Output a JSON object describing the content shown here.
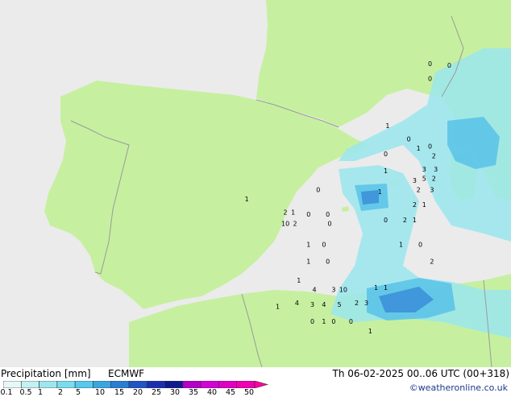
{
  "header": {
    "title": "Precipitation [mm]",
    "model": "ECMWF",
    "datetime": "Th 06-02-2025 00..06 UTC (00+318)",
    "credit": "©weatheronline.co.uk"
  },
  "legend": {
    "levels": [
      "0.1",
      "0.5",
      "1",
      "2",
      "5",
      "10",
      "15",
      "20",
      "25",
      "30",
      "35",
      "40",
      "45",
      "50"
    ],
    "colors": [
      "#e6f7f7",
      "#c3f0f0",
      "#9ee6ee",
      "#7adcee",
      "#58c8ec",
      "#3aa6e0",
      "#2a7ed2",
      "#1f55c4",
      "#1a2fb0",
      "#0f1a8c",
      "#b400c8",
      "#d400d8",
      "#e000c4",
      "#f000b0",
      "#ff00a0"
    ]
  },
  "colors": {
    "land": "#c6f0a0",
    "sea": "#ebebeb",
    "border": "#9a9a9a",
    "coast": "#8a8a8a",
    "precip_light": "#9ae6ee",
    "precip_mid": "#58c2e8",
    "precip_heavy": "#3a8ed8"
  },
  "map": {
    "point_values": [
      {
        "v": "0",
        "lon": 10.3,
        "lat": 47.0
      },
      {
        "v": "0",
        "lon": 11.3,
        "lat": 46.9
      },
      {
        "v": "0",
        "lon": 10.3,
        "lat": 46.2
      },
      {
        "v": "1",
        "lon": 8.1,
        "lat": 43.7
      },
      {
        "v": "0",
        "lon": 9.2,
        "lat": 43.0
      },
      {
        "v": "1",
        "lon": 9.7,
        "lat": 42.5
      },
      {
        "v": "0",
        "lon": 10.3,
        "lat": 42.6
      },
      {
        "v": "2",
        "lon": 10.5,
        "lat": 42.1
      },
      {
        "v": "0",
        "lon": 8.0,
        "lat": 42.2
      },
      {
        "v": "3",
        "lon": 10.0,
        "lat": 41.4
      },
      {
        "v": "3",
        "lon": 10.6,
        "lat": 41.4
      },
      {
        "v": "1",
        "lon": 8.0,
        "lat": 41.3
      },
      {
        "v": "3",
        "lon": 9.5,
        "lat": 40.8
      },
      {
        "v": "5",
        "lon": 10.0,
        "lat": 40.9
      },
      {
        "v": "2",
        "lon": 10.5,
        "lat": 40.9
      },
      {
        "v": "0",
        "lon": 4.5,
        "lat": 40.3
      },
      {
        "v": "1",
        "lon": 7.7,
        "lat": 40.2
      },
      {
        "v": "2",
        "lon": 9.7,
        "lat": 40.3
      },
      {
        "v": "3",
        "lon": 10.4,
        "lat": 40.3
      },
      {
        "v": "1",
        "lon": 0.8,
        "lat": 39.8
      },
      {
        "v": "2",
        "lon": 2.8,
        "lat": 39.1
      },
      {
        "v": "1",
        "lon": 3.2,
        "lat": 39.1
      },
      {
        "v": "0",
        "lon": 4.0,
        "lat": 39.0
      },
      {
        "v": "0",
        "lon": 5.0,
        "lat": 39.0
      },
      {
        "v": "2",
        "lon": 9.5,
        "lat": 39.5
      },
      {
        "v": "1",
        "lon": 10.0,
        "lat": 39.5
      },
      {
        "v": "0",
        "lon": 8.0,
        "lat": 38.7
      },
      {
        "v": "2",
        "lon": 9.0,
        "lat": 38.7
      },
      {
        "v": "1",
        "lon": 9.5,
        "lat": 38.7
      },
      {
        "v": "10",
        "lon": 2.8,
        "lat": 38.5
      },
      {
        "v": "2",
        "lon": 3.3,
        "lat": 38.5
      },
      {
        "v": "0",
        "lon": 5.1,
        "lat": 38.5
      },
      {
        "v": "1",
        "lon": 4.0,
        "lat": 37.4
      },
      {
        "v": "0",
        "lon": 4.8,
        "lat": 37.4
      },
      {
        "v": "1",
        "lon": 8.8,
        "lat": 37.4
      },
      {
        "v": "0",
        "lon": 9.8,
        "lat": 37.4
      },
      {
        "v": "1",
        "lon": 4.0,
        "lat": 36.5
      },
      {
        "v": "0",
        "lon": 5.0,
        "lat": 36.5
      },
      {
        "v": "2",
        "lon": 10.4,
        "lat": 36.5
      },
      {
        "v": "1",
        "lon": 3.5,
        "lat": 35.5
      },
      {
        "v": "4",
        "lon": 4.3,
        "lat": 35.0
      },
      {
        "v": "3",
        "lon": 5.3,
        "lat": 35.0
      },
      {
        "v": "10",
        "lon": 5.8,
        "lat": 35.0
      },
      {
        "v": "1",
        "lon": 7.5,
        "lat": 35.1
      },
      {
        "v": "1",
        "lon": 8.0,
        "lat": 35.1
      },
      {
        "v": "4",
        "lon": 3.4,
        "lat": 34.3
      },
      {
        "v": "3",
        "lon": 4.2,
        "lat": 34.2
      },
      {
        "v": "4",
        "lon": 4.8,
        "lat": 34.2
      },
      {
        "v": "5",
        "lon": 5.6,
        "lat": 34.2
      },
      {
        "v": "2",
        "lon": 6.5,
        "lat": 34.3
      },
      {
        "v": "3",
        "lon": 7.0,
        "lat": 34.3
      },
      {
        "v": "1",
        "lon": 2.4,
        "lat": 34.1
      },
      {
        "v": "0",
        "lon": 4.2,
        "lat": 33.3
      },
      {
        "v": "1",
        "lon": 4.8,
        "lat": 33.3
      },
      {
        "v": "0",
        "lon": 5.3,
        "lat": 33.3
      },
      {
        "v": "0",
        "lon": 6.2,
        "lat": 33.3
      },
      {
        "v": "1",
        "lon": 7.2,
        "lat": 32.8
      }
    ]
  }
}
